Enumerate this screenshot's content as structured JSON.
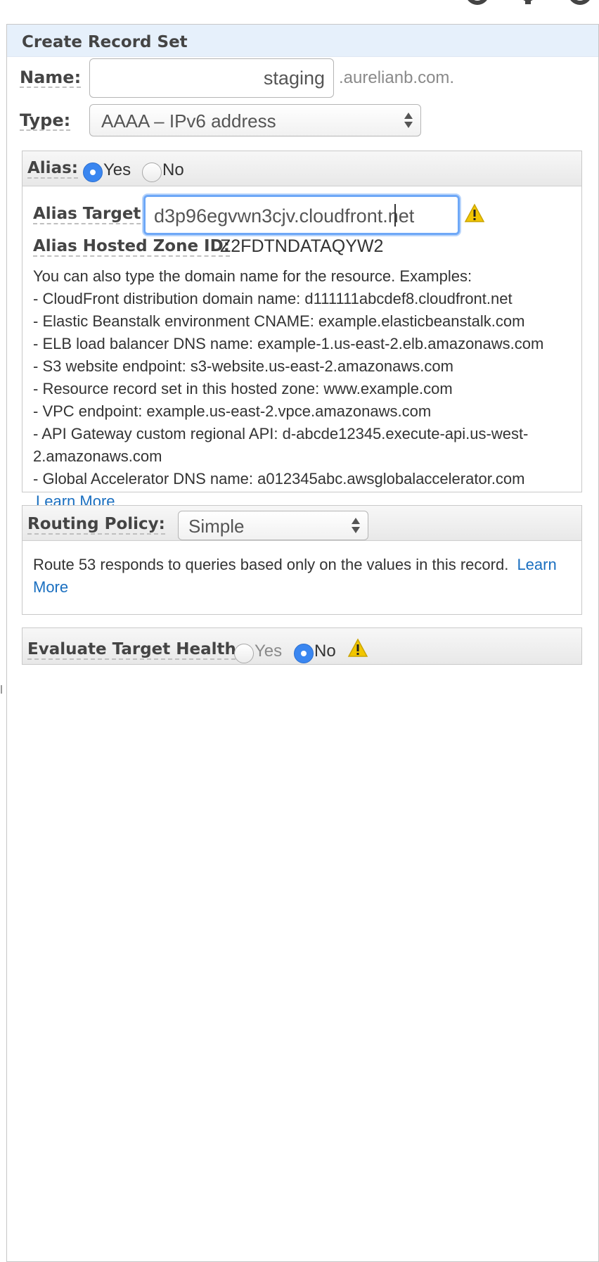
{
  "panel": {
    "title": "Create Record Set"
  },
  "name_field": {
    "label": "Name:",
    "value": "staging",
    "suffix": ".aurelianb.com."
  },
  "type_field": {
    "label": "Type:",
    "value": "AAAA – IPv6 address"
  },
  "alias": {
    "label": "Alias:",
    "yes_label": "Yes",
    "no_label": "No",
    "selected": "Yes",
    "target_label": "Alias Target:",
    "target_value": "d3p96egvwn3cjv.cloudfront.net",
    "zone_label": "Alias Hosted Zone ID:",
    "zone_value": "Z2FDTNDATAQYW2",
    "help_intro": "You can also type the domain name for the resource. Examples:",
    "examples": [
      "-  CloudFront distribution domain name: d111111abcdef8.cloudfront.net",
      "-  Elastic Beanstalk environment CNAME: example.elasticbeanstalk.com",
      "-  ELB load balancer DNS name: example-1.us-east-2.elb.amazonaws.com",
      "-  S3 website endpoint: s3-website.us-east-2.amazonaws.com",
      "-  Resource record set in this hosted zone: www.example.com",
      "-  VPC endpoint: example.us-east-2.vpce.amazonaws.com",
      "-  API Gateway custom regional API: d-abcde12345.execute-api.us-west-",
      "2.amazonaws.com",
      "-  Global Accelerator DNS name: a012345abc.awsglobalaccelerator.com"
    ],
    "learn_more": "Learn More"
  },
  "routing": {
    "label": "Routing Policy:",
    "value": "Simple",
    "description": "Route 53 responds to queries based only on the values in this record.",
    "learn_1": "Learn",
    "learn_2": "More"
  },
  "health": {
    "label": "Evaluate Target Health:",
    "yes_label": "Yes",
    "no_label": "No",
    "selected": "No"
  },
  "icons": {
    "top": [
      "refresh-icon",
      "gear-icon",
      "help-icon"
    ],
    "warning": "warning-icon",
    "accent": "#3a86f0",
    "link": "#1a6fc0",
    "warning_color": "#f2c600"
  }
}
